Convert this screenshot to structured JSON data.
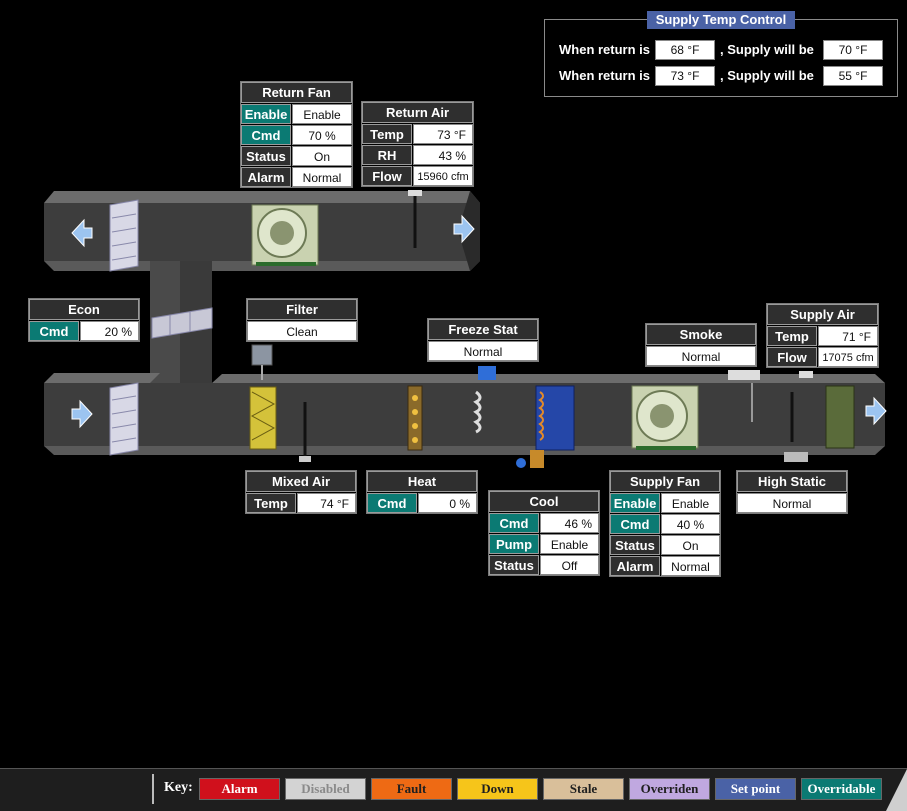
{
  "supply_temp_control": {
    "title": "Supply Temp Control",
    "row1": {
      "prefix": "When return is",
      "return_value": "68 °F",
      "mid": ", Supply will be",
      "supply_value": "70 °F"
    },
    "row2": {
      "prefix": "When return is",
      "return_value": "73 °F",
      "mid": ", Supply will be",
      "supply_value": "55 °F"
    }
  },
  "return_fan": {
    "title": "Return Fan",
    "rows": [
      {
        "label": "Enable",
        "value": "Enable"
      },
      {
        "label": "Cmd",
        "value": "70 %"
      },
      {
        "label": "Status",
        "value": "On"
      },
      {
        "label": "Alarm",
        "value": "Normal"
      }
    ]
  },
  "return_air": {
    "title": "Return Air",
    "rows": [
      {
        "label": "Temp",
        "value": "73 °F"
      },
      {
        "label": "RH",
        "value": "43 %"
      },
      {
        "label": "Flow",
        "value": "15960 cfm"
      }
    ]
  },
  "econ": {
    "title": "Econ",
    "label": "Cmd",
    "value": "20 %"
  },
  "filter": {
    "title": "Filter",
    "value": "Clean"
  },
  "freeze_stat": {
    "title": "Freeze Stat",
    "value": "Normal"
  },
  "smoke": {
    "title": "Smoke",
    "value": "Normal"
  },
  "supply_air": {
    "title": "Supply Air",
    "rows": [
      {
        "label": "Temp",
        "value": "71 °F"
      },
      {
        "label": "Flow",
        "value": "17075 cfm"
      }
    ]
  },
  "mixed_air": {
    "title": "Mixed Air",
    "label": "Temp",
    "value": "74 °F"
  },
  "heat": {
    "title": "Heat",
    "label": "Cmd",
    "value": "0 %"
  },
  "cool": {
    "title": "Cool",
    "rows": [
      {
        "label": "Cmd",
        "value": "46 %"
      },
      {
        "label": "Pump",
        "value": "Enable"
      },
      {
        "label": "Status",
        "value": "Off"
      }
    ]
  },
  "supply_fan": {
    "title": "Supply Fan",
    "rows": [
      {
        "label": "Enable",
        "value": "Enable"
      },
      {
        "label": "Cmd",
        "value": "40 %"
      },
      {
        "label": "Status",
        "value": "On"
      },
      {
        "label": "Alarm",
        "value": "Normal"
      }
    ]
  },
  "high_static": {
    "title": "High Static",
    "value": "Normal"
  },
  "key": {
    "label": "Key:",
    "items": [
      {
        "text": "Alarm",
        "bg": "#d0101c",
        "fg": "#ffffff"
      },
      {
        "text": "Disabled",
        "bg": "#d3d3d3",
        "fg": "#8a8a8a"
      },
      {
        "text": "Fault",
        "bg": "#ee6a14",
        "fg": "#202020"
      },
      {
        "text": "Down",
        "bg": "#f6c51a",
        "fg": "#202020"
      },
      {
        "text": "Stale",
        "bg": "#d9bf9a",
        "fg": "#202020"
      },
      {
        "text": "Overriden",
        "bg": "#c0a8e0",
        "fg": "#202020"
      },
      {
        "text": "Set point",
        "bg": "#4a62a6",
        "fg": "#ffffff"
      },
      {
        "text": "Overridable",
        "bg": "#0b7a73",
        "fg": "#ffffff"
      }
    ]
  },
  "colors": {
    "teal_label": "#0b7a73",
    "setpoint_blue": "#4a62a6",
    "duct_gray": "#4a4a4a"
  }
}
